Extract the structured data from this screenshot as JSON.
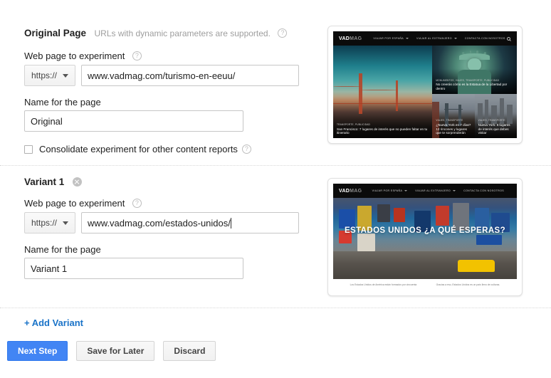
{
  "original": {
    "section_title": "Original Page",
    "section_hint": "URLs with dynamic parameters are supported.",
    "help_icon": "help-icon",
    "url_label": "Web page to experiment",
    "url_help_icon": "help-icon",
    "protocol": "https://",
    "url_value": "www.vadmag.com/turismo-en-eeuu/",
    "name_label": "Name for the page",
    "name_value": "Original",
    "consolidate_label": "Consolidate experiment for other content reports",
    "consolidate_help_icon": "help-icon",
    "consolidate_checked": false
  },
  "variant": {
    "section_title": "Variant 1",
    "remove_icon": "remove-circle-icon",
    "url_label": "Web page to experiment",
    "url_help_icon": "help-icon",
    "protocol": "https://",
    "url_value": "www.vadmag.com/estados-unidos/",
    "name_label": "Name for the page",
    "name_value": "Variant 1"
  },
  "actions": {
    "add_variant": "+ Add Variant",
    "next_step": "Next Step",
    "save_for_later": "Save for Later",
    "discard": "Discard"
  },
  "preview_original": {
    "logo_main": "VAD",
    "logo_sub": "MAG",
    "nav": [
      "VIAJAR POR ESPAÑA",
      "VIAJAR AL EXTRANJERO",
      "CONTACTA CON NOSOTROS"
    ],
    "search_icon": "search-icon",
    "articles": [
      {
        "kicker": "TRANSPORTE, PUBLICIDAD",
        "title": "San Francisco: 7 lugares de interés que no pueden faltar en tu itinerario"
      },
      {
        "kicker": "MONUMENTOS, VIAJES, TRANSPORTE, PUBLICIDAD",
        "title": "No creerás cómo es la Estatua de la Libertad por dentro"
      },
      {
        "kicker": "VIAJES, TRANSPORTE",
        "title": "¿Nueva York en 7 días? 12 rincones y lugares que te sorprenderán"
      },
      {
        "kicker": "VIAJES, TRANSPORTE",
        "title": "Nueva York: 6 lugares de interés que debes visitar"
      }
    ]
  },
  "preview_variant": {
    "logo_main": "VAD",
    "logo_sub": "MAG",
    "nav": [
      "VIAJAR POR ESPAÑA",
      "VIAJAR AL EXTRANJERO",
      "CONTACTA CON NOSOTROS"
    ],
    "hero_title": "ESTADOS UNIDOS ¿A QUÉ ESPERAS?",
    "footer_left": "Los Estados Unidos de América están formados por cincuenta",
    "footer_right": "Gracias a eso, Estados Unidos es un país lleno de culturas."
  },
  "colors": {
    "primary_blue": "#4285f4",
    "link_blue": "#1a73c8",
    "border_gray": "#c6c6c6",
    "hint_gray": "#9e9e9e"
  }
}
